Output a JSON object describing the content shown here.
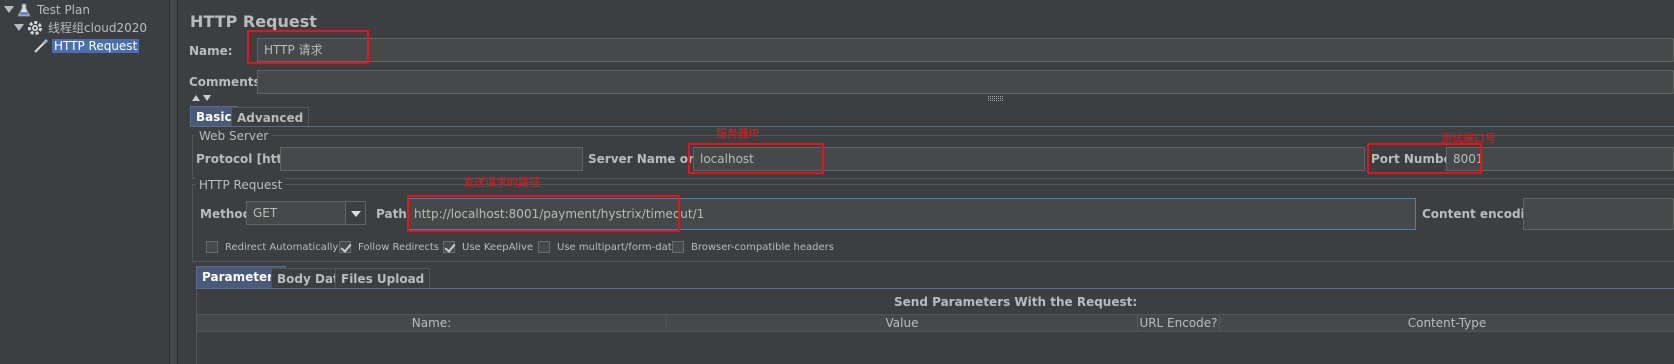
{
  "tree": {
    "items": [
      {
        "label": "Test Plan"
      },
      {
        "label": "线程组cloud2020"
      },
      {
        "label": "HTTP Request"
      }
    ]
  },
  "panel": {
    "title": "HTTP Request",
    "name_label": "Name:",
    "name_value": "HTTP 请求",
    "comments_label": "Comments:",
    "comments_value": "",
    "tabs": [
      {
        "label": "Basic"
      },
      {
        "label": "Advanced"
      }
    ]
  },
  "web_server": {
    "title": "Web Server",
    "protocol_label": "Protocol [http]:",
    "protocol_value": "",
    "server_label": "Server Name or IP:",
    "server_value": "localhost",
    "port_label": "Port Number:",
    "port_value": "8001",
    "note_server": "服务器IP",
    "note_port": "测试端口号"
  },
  "http_request": {
    "title": "HTTP Request",
    "method_label": "Method:",
    "method_value": "GET",
    "path_label": "Path:",
    "path_value": "http://localhost:8001/payment/hystrix/timeout/1",
    "encoding_label": "Content encoding:",
    "encoding_value": "",
    "note_path": "发送请求的路径",
    "checkboxes": [
      {
        "label": "Redirect Automatically",
        "checked": false
      },
      {
        "label": "Follow Redirects",
        "checked": true
      },
      {
        "label": "Use KeepAlive",
        "checked": true
      },
      {
        "label": "Use multipart/form-data",
        "checked": false
      },
      {
        "label": "Browser-compatible headers",
        "checked": false
      }
    ]
  },
  "params": {
    "tabs": [
      {
        "label": "Parameters"
      },
      {
        "label": "Body Data"
      },
      {
        "label": "Files Upload"
      }
    ],
    "heading": "Send Parameters With the Request:",
    "columns": [
      "Name:",
      "Value",
      "URL Encode?",
      "Content-Type"
    ]
  },
  "colors": {
    "background": "#3c3f41",
    "field": "#45494a",
    "selection": "#4b6eaf",
    "annotation": "#e5131b"
  }
}
